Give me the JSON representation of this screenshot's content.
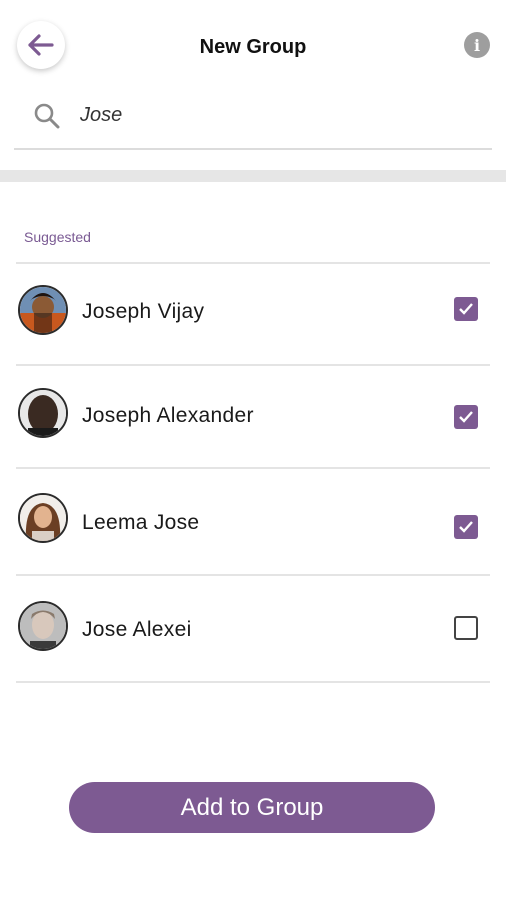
{
  "header": {
    "title": "New Group",
    "back_icon": "arrow-left-icon",
    "info_icon": "info-icon",
    "info_glyph": "i"
  },
  "search": {
    "value": "Jose",
    "icon": "search-icon"
  },
  "section": {
    "label": "Suggested"
  },
  "contacts": [
    {
      "name": "Joseph Vijay",
      "checked": true
    },
    {
      "name": "Joseph Alexander",
      "checked": true
    },
    {
      "name": "Leema Jose",
      "checked": true
    },
    {
      "name": "Jose Alexei",
      "checked": false
    }
  ],
  "actions": {
    "add_label": "Add to Group"
  },
  "colors": {
    "accent": "#7d5a92",
    "muted": "#9e9e9e"
  }
}
